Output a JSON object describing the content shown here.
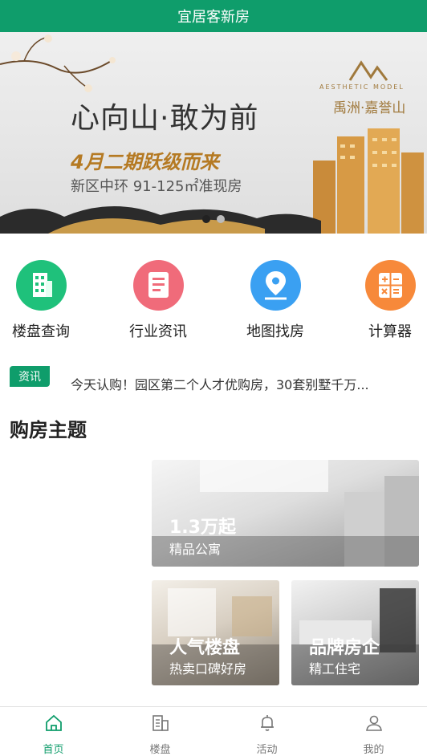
{
  "header": {
    "title": "宜居客新房"
  },
  "banner": {
    "slogan": "心向山·敢为前",
    "phase": "4月二期跃级而来",
    "subline": "新区中环 91-125㎡准现房",
    "brand_en": "AESTHETIC MODEL",
    "brand_cn": "禹洲·嘉誉山",
    "slides_total": 2,
    "active_slide": 1
  },
  "quick_menu": [
    {
      "label": "楼盘查询",
      "icon": "building-icon",
      "color": "#1fc17b"
    },
    {
      "label": "行业资讯",
      "icon": "document-icon",
      "color": "#f06b7a"
    },
    {
      "label": "地图找房",
      "icon": "map-pin-icon",
      "color": "#3aa0f2"
    },
    {
      "label": "计算器",
      "icon": "calculator-icon",
      "color": "#f7893a"
    }
  ],
  "news": {
    "tag": "资讯",
    "text": "今天认购！园区第二个人才优购房，30套别墅千万..."
  },
  "section": {
    "title": "购房主题"
  },
  "themes": [
    {
      "title": "1.3万起",
      "subtitle": "精品公寓"
    },
    {
      "title": "人气楼盘",
      "subtitle": "热卖口碑好房"
    },
    {
      "title": "品牌房企",
      "subtitle": "精工住宅"
    }
  ],
  "bottom_nav": [
    {
      "label": "首页",
      "icon": "home-icon",
      "active": true
    },
    {
      "label": "楼盘",
      "icon": "building-list-icon",
      "active": false
    },
    {
      "label": "活动",
      "icon": "bell-icon",
      "active": false
    },
    {
      "label": "我的",
      "icon": "user-icon",
      "active": false
    }
  ],
  "colors": {
    "brand": "#0f9d6b"
  }
}
